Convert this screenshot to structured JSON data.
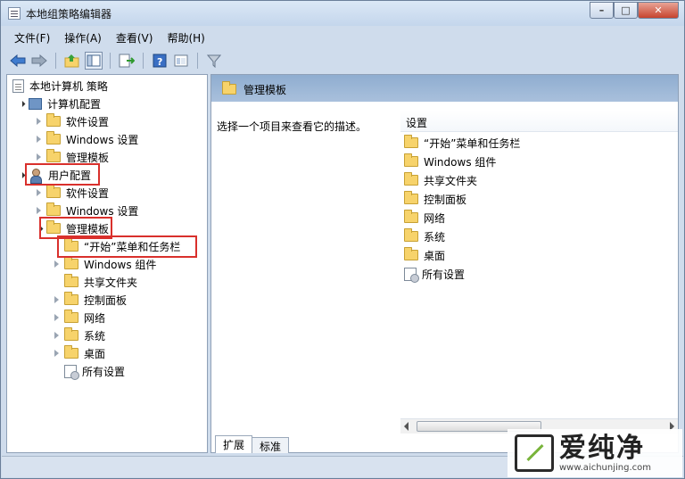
{
  "window": {
    "title": "本地组策略编辑器",
    "controls": [
      "–",
      "□",
      "✕"
    ]
  },
  "menu": [
    "文件(F)",
    "操作(A)",
    "查看(V)",
    "帮助(H)"
  ],
  "toolbar": {
    "icons": [
      "back-arrow-icon",
      "forward-arrow-icon",
      "up-folder-icon",
      "show-hide-tree-icon",
      "export-list-icon",
      "help-icon",
      "show-extended-view-icon",
      "filter-icon"
    ]
  },
  "tree": {
    "root": "本地计算机 策略",
    "computer_config": "计算机配置",
    "computer_children": [
      "软件设置",
      "Windows 设置",
      "管理模板"
    ],
    "user_config": "用户配置",
    "user_children": [
      "软件设置",
      "Windows 设置",
      "管理模板"
    ],
    "admin_templates_children": [
      "“开始”菜单和任务栏",
      "Windows 组件",
      "共享文件夹",
      "控制面板",
      "网络",
      "系统",
      "桌面",
      "所有设置"
    ]
  },
  "right": {
    "header_title": "管理模板",
    "description": "选择一个项目来查看它的描述。",
    "column_header": "设置",
    "items": [
      "“开始”菜单和任务栏",
      "Windows 组件",
      "共享文件夹",
      "控制面板",
      "网络",
      "系统",
      "桌面",
      "所有设置"
    ],
    "tabs": [
      "扩展",
      "标准"
    ]
  },
  "watermark": {
    "brand": "爱纯净",
    "url": "www.aichunjing.com"
  },
  "colors": {
    "highlight_box": "#d9302c",
    "header_band": "#8fadd0",
    "folder": "#f7d36b"
  }
}
